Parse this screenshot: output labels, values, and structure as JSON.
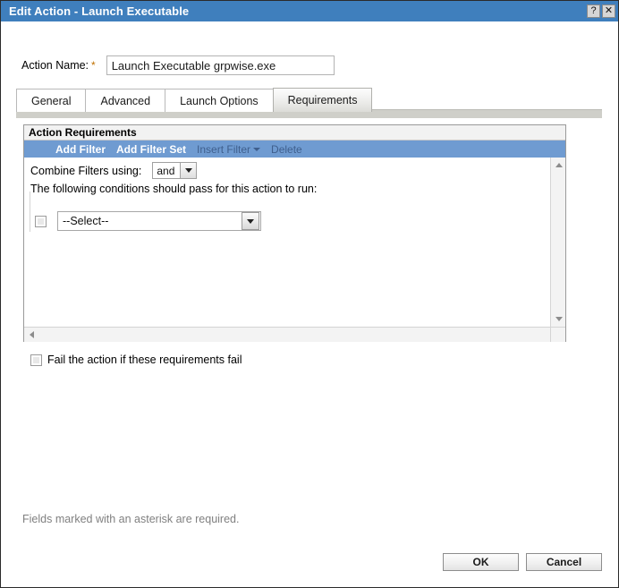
{
  "window": {
    "title": "Edit Action - Launch Executable",
    "help_button": "?",
    "close_button": "✕"
  },
  "form": {
    "action_name_label": "Action Name:",
    "required_marker": "*",
    "action_name_value": "Launch Executable grpwise.exe",
    "action_name_placeholder": ""
  },
  "tabs": [
    {
      "label": "General",
      "active": false
    },
    {
      "label": "Advanced",
      "active": false
    },
    {
      "label": "Launch Options",
      "active": false
    },
    {
      "label": "Requirements",
      "active": true
    }
  ],
  "panel": {
    "header": "Action Requirements",
    "toolbar": [
      {
        "label": "Add Filter",
        "disabled": false
      },
      {
        "label": "Add Filter Set",
        "disabled": false
      },
      {
        "label": "Insert Filter",
        "disabled": true,
        "has_caret": true
      },
      {
        "label": "Delete",
        "disabled": true
      }
    ],
    "combine_label": "Combine Filters using:",
    "combine_value": "and",
    "conditions_text": "The following conditions should pass for this action to run:",
    "filter_rows": [
      {
        "select_value": "--Select--",
        "checked": false
      }
    ]
  },
  "fail_option": {
    "label": "Fail the action if these requirements fail",
    "checked": false
  },
  "footer": {
    "note": "Fields marked with an asterisk are required.",
    "ok_label": "OK",
    "cancel_label": "Cancel"
  },
  "colors": {
    "titlebar": "#3f7fbd",
    "toolbar": "#6f9bd1",
    "toolbar_disabled_text": "#3f5f8d",
    "tab_active": "#e6e6e2",
    "asterisk": "#c07000",
    "footnote": "#808080"
  }
}
